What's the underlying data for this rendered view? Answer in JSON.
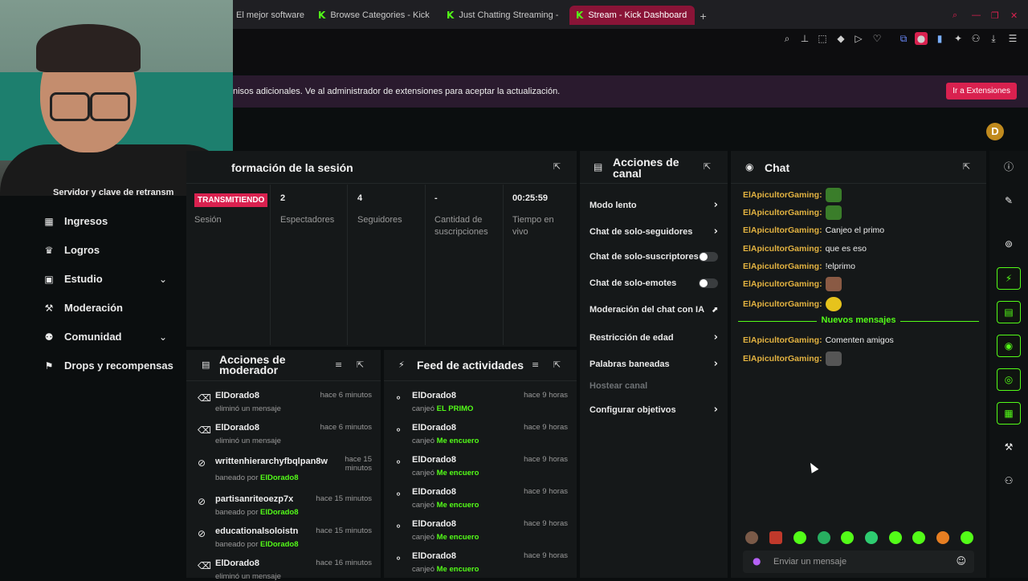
{
  "browser": {
    "tabs": [
      {
        "label": "El mejor software",
        "active": false,
        "kick": false
      },
      {
        "label": "Browse Categories - Kick",
        "active": false,
        "kick": true
      },
      {
        "label": "Just Chatting Streaming -",
        "active": false,
        "kick": true
      },
      {
        "label": "Stream - Kick Dashboard",
        "active": true,
        "kick": true
      }
    ],
    "new_tab": "+"
  },
  "extension_bar": {
    "message": "nisos adicionales. Ve al administrador de extensiones para aceptar la actualización.",
    "button": "Ir a Extensiones"
  },
  "header": {
    "avatar_letter": "D"
  },
  "sidebar": {
    "truncated_item": "Servidor y clave de retransm",
    "items": [
      {
        "label": "Ingresos",
        "icon": "chart-icon",
        "expandable": false
      },
      {
        "label": "Logros",
        "icon": "trophy-icon",
        "expandable": false
      },
      {
        "label": "Estudio",
        "icon": "studio-icon",
        "expandable": true
      },
      {
        "label": "Moderación",
        "icon": "wrench-icon",
        "expandable": false
      },
      {
        "label": "Comunidad",
        "icon": "community-icon",
        "expandable": true
      },
      {
        "label": "Drops y recompensas",
        "icon": "gift-icon",
        "expandable": false
      }
    ]
  },
  "session": {
    "title": "formación de la sesión",
    "status_badge": "TRANSMITIENDO",
    "status_label": "Sesión",
    "stats": [
      {
        "value": "2",
        "label": "Espectadores"
      },
      {
        "value": "4",
        "label": "Seguidores"
      },
      {
        "value": "-",
        "label": "Cantidad de suscripciones"
      },
      {
        "value": "00:25:59",
        "label": "Tiempo en vivo"
      }
    ]
  },
  "channel_actions": {
    "title": "Acciones de canal",
    "rows": [
      {
        "label": "Modo lento",
        "control": "arrow"
      },
      {
        "label": "Chat de solo-seguidores",
        "control": "arrow"
      },
      {
        "label": "Chat de solo-suscriptores",
        "control": "toggle"
      },
      {
        "label": "Chat de solo-emotes",
        "control": "toggle"
      },
      {
        "label": "Moderación del chat con IA",
        "control": "external"
      },
      {
        "label": "Restricción de edad",
        "control": "arrow"
      },
      {
        "label": "Palabras baneadas",
        "control": "arrow"
      },
      {
        "label": "Hostear canal",
        "control": "none"
      },
      {
        "label": "Configurar objetivos",
        "control": "arrow"
      }
    ]
  },
  "mod_actions": {
    "title": "Acciones de moderador",
    "rows": [
      {
        "user": "ElDorado8",
        "time": "hace 6 minutos",
        "desc": "eliminó un mensaje",
        "by": "",
        "icon": "trash"
      },
      {
        "user": "ElDorado8",
        "time": "hace 6 minutos",
        "desc": "eliminó un mensaje",
        "by": "",
        "icon": "trash"
      },
      {
        "user": "writtenhierarchyfbqlpan8w",
        "time": "hace 15 minutos",
        "desc": "baneado por",
        "by": "ElDorado8",
        "icon": "ban"
      },
      {
        "user": "partisanriteoezp7x",
        "time": "hace 15 minutos",
        "desc": "baneado por",
        "by": "ElDorado8",
        "icon": "ban"
      },
      {
        "user": "educationalsoloistn",
        "time": "hace 15 minutos",
        "desc": "baneado por",
        "by": "ElDorado8",
        "icon": "ban"
      },
      {
        "user": "ElDorado8",
        "time": "hace 16 minutos",
        "desc": "eliminó un mensaje",
        "by": "",
        "icon": "trash"
      }
    ]
  },
  "activity_feed": {
    "title": "Feed de actividades",
    "rows": [
      {
        "user": "ElDorado8",
        "time": "hace 9 horas",
        "desc": "canjeó",
        "reward": "EL PRIMO"
      },
      {
        "user": "ElDorado8",
        "time": "hace 9 horas",
        "desc": "canjeó",
        "reward": "Me encuero"
      },
      {
        "user": "ElDorado8",
        "time": "hace 9 horas",
        "desc": "canjeó",
        "reward": "Me encuero"
      },
      {
        "user": "ElDorado8",
        "time": "hace 9 horas",
        "desc": "canjeó",
        "reward": "Me encuero"
      },
      {
        "user": "ElDorado8",
        "time": "hace 9 horas",
        "desc": "canjeó",
        "reward": "Me encuero"
      },
      {
        "user": "ElDorado8",
        "time": "hace 9 horas",
        "desc": "canjeó",
        "reward": "Me encuero"
      }
    ]
  },
  "chat": {
    "title": "Chat",
    "messages": [
      {
        "user": "ElApicultorGaming:",
        "text": "",
        "emote": "#3a7d2a"
      },
      {
        "user": "ElApicultorGaming:",
        "text": "",
        "emote": "#3a7d2a"
      },
      {
        "user": "ElApicultorGaming:",
        "text": "Canjeo el primo",
        "emote": ""
      },
      {
        "user": "ElApicultorGaming:",
        "text": "que es eso",
        "emote": ""
      },
      {
        "user": "ElApicultorGaming:",
        "text": "!elprimo",
        "emote": ""
      },
      {
        "user": "ElApicultorGaming:",
        "text": "",
        "emote": "#8a5a44"
      },
      {
        "user": "ElApicultorGaming:",
        "text": "",
        "emote": "#e6c31c"
      },
      {
        "user": "ElApicultorGaming:",
        "text": "Comenten amigos",
        "emote": ""
      },
      {
        "user": "ElApicultorGaming:",
        "text": "",
        "emote": "#555555"
      }
    ],
    "new_messages": "Nuevos mensajes",
    "input_placeholder": "Enviar un mensaje",
    "emote_bar": [
      "#7a5a48",
      "#c0392b",
      "#53fc18",
      "#27ae60",
      "#53fc18",
      "#2ecc71",
      "#53fc18",
      "#53fc18",
      "#e67e22",
      "#53fc18"
    ]
  },
  "colors": {
    "accent": "#53fc18",
    "brand_red": "#d9214f",
    "username": "#e3b341"
  }
}
